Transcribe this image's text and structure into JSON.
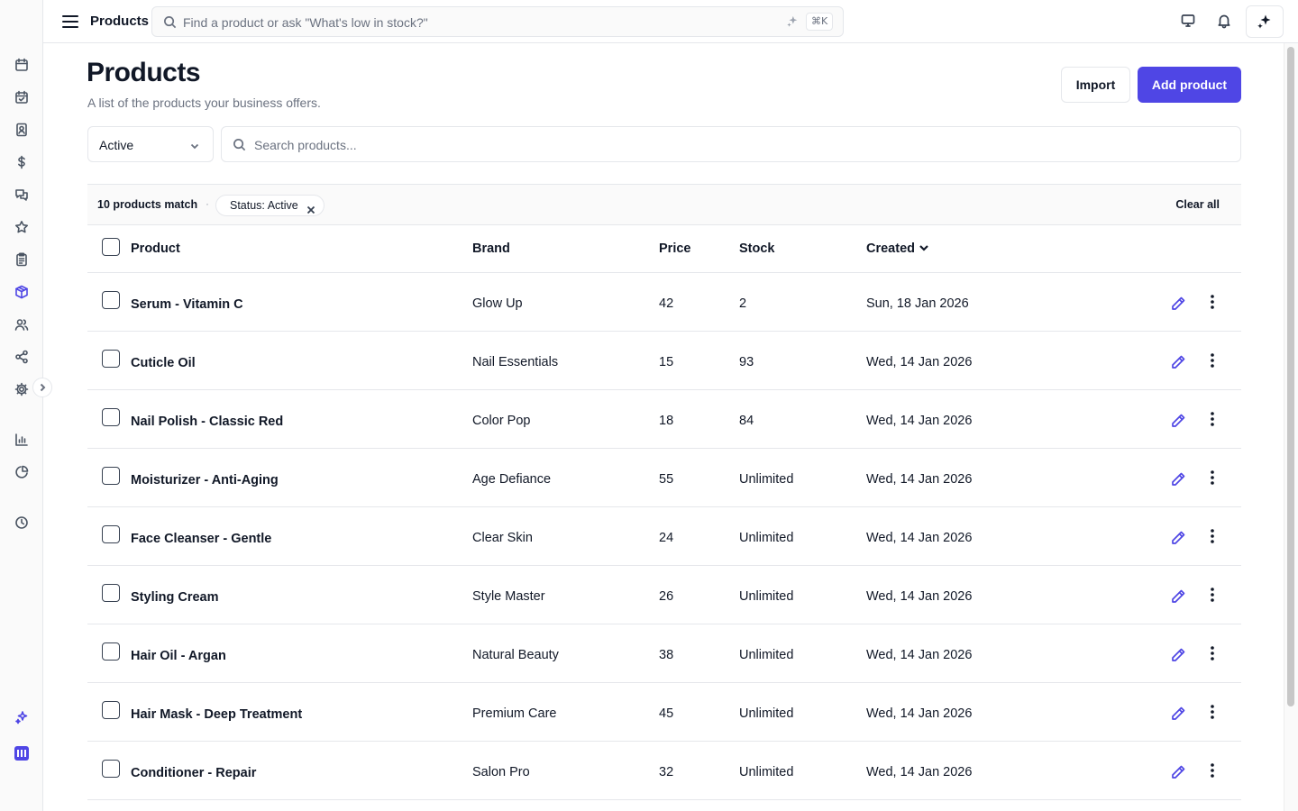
{
  "topbar": {
    "title": "Products",
    "search_placeholder": "Find a product or ask \"What's low in stock?\"",
    "shortcut": "⌘K"
  },
  "page": {
    "title": "Products",
    "subtitle": "A list of the products your business offers.",
    "import_label": "Import",
    "add_label": "Add product"
  },
  "filters": {
    "status_value": "Active",
    "search_placeholder": "Search products..."
  },
  "match": {
    "count_text": "10 products match",
    "separator": "·",
    "chip_label": "Status: Active",
    "clear_label": "Clear all"
  },
  "table": {
    "columns": {
      "product": "Product",
      "brand": "Brand",
      "price": "Price",
      "stock": "Stock",
      "created": "Created"
    },
    "rows": [
      {
        "name": "Serum - Vitamin C",
        "brand": "Glow Up",
        "price": "42",
        "stock": "2",
        "created": "Sun, 18 Jan 2026"
      },
      {
        "name": "Cuticle Oil",
        "brand": "Nail Essentials",
        "price": "15",
        "stock": "93",
        "created": "Wed, 14 Jan 2026"
      },
      {
        "name": "Nail Polish - Classic Red",
        "brand": "Color Pop",
        "price": "18",
        "stock": "84",
        "created": "Wed, 14 Jan 2026"
      },
      {
        "name": "Moisturizer - Anti-Aging",
        "brand": "Age Defiance",
        "price": "55",
        "stock": "Unlimited",
        "created": "Wed, 14 Jan 2026"
      },
      {
        "name": "Face Cleanser - Gentle",
        "brand": "Clear Skin",
        "price": "24",
        "stock": "Unlimited",
        "created": "Wed, 14 Jan 2026"
      },
      {
        "name": "Styling Cream",
        "brand": "Style Master",
        "price": "26",
        "stock": "Unlimited",
        "created": "Wed, 14 Jan 2026"
      },
      {
        "name": "Hair Oil - Argan",
        "brand": "Natural Beauty",
        "price": "38",
        "stock": "Unlimited",
        "created": "Wed, 14 Jan 2026"
      },
      {
        "name": "Hair Mask - Deep Treatment",
        "brand": "Premium Care",
        "price": "45",
        "stock": "Unlimited",
        "created": "Wed, 14 Jan 2026"
      },
      {
        "name": "Conditioner - Repair",
        "brand": "Salon Pro",
        "price": "32",
        "stock": "Unlimited",
        "created": "Wed, 14 Jan 2026"
      }
    ]
  },
  "sidebar": {
    "icons": [
      "calendar-icon",
      "calendar-check-icon",
      "contact-book-icon",
      "dollar-icon",
      "chat-icon",
      "star-icon",
      "clipboard-icon",
      "box-icon",
      "users-icon",
      "share-icon",
      "gear-icon",
      "bar-chart-icon",
      "pie-chart-icon",
      "clock-icon",
      "sparkles-icon",
      "brand-logo-icon"
    ]
  },
  "colors": {
    "accent": "#4f46e5",
    "border": "#e5e7eb",
    "muted_text": "#6b7280"
  }
}
